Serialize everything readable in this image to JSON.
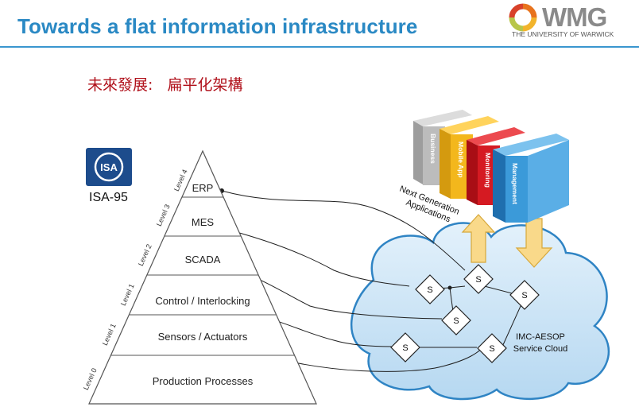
{
  "header": {
    "title": "Towards a flat information infrastructure",
    "logo_word": "WMG",
    "logo_university": "THE UNIVERSITY OF WARWICK"
  },
  "subtitle": "未來發展:   扁平化架構",
  "isa": {
    "badge_text": "ISA",
    "label": "ISA-95"
  },
  "pyramid": {
    "layers": [
      {
        "label": "ERP",
        "level": "Level 4"
      },
      {
        "label": "MES",
        "level": "Level 3"
      },
      {
        "label": "SCADA",
        "level": "Level 2"
      },
      {
        "label": "Control / Interlocking",
        "level": "Level 1"
      },
      {
        "label": "Sensors / Actuators",
        "level": "Level 1"
      },
      {
        "label": "Production Processes",
        "level": "Level 0"
      }
    ]
  },
  "applications": {
    "caption_line1": "Next Generation",
    "caption_line2": "Applications",
    "blocks": [
      {
        "label": "Business",
        "color": "#b9b9b9"
      },
      {
        "label": "Mobile App",
        "color": "#f3b71c"
      },
      {
        "label": "Monitoring",
        "color": "#d51a22"
      },
      {
        "label": "Management",
        "color": "#3b9ad9"
      }
    ]
  },
  "cloud": {
    "label_line1": "IMC-AESOP",
    "label_line2": "Service Cloud",
    "service_label": "S",
    "fill": "#cfe6f7",
    "stroke": "#2f84c4"
  },
  "colors": {
    "title": "#2a89c4",
    "subtitle": "#b0101a",
    "arrow": "#f9d98a"
  }
}
